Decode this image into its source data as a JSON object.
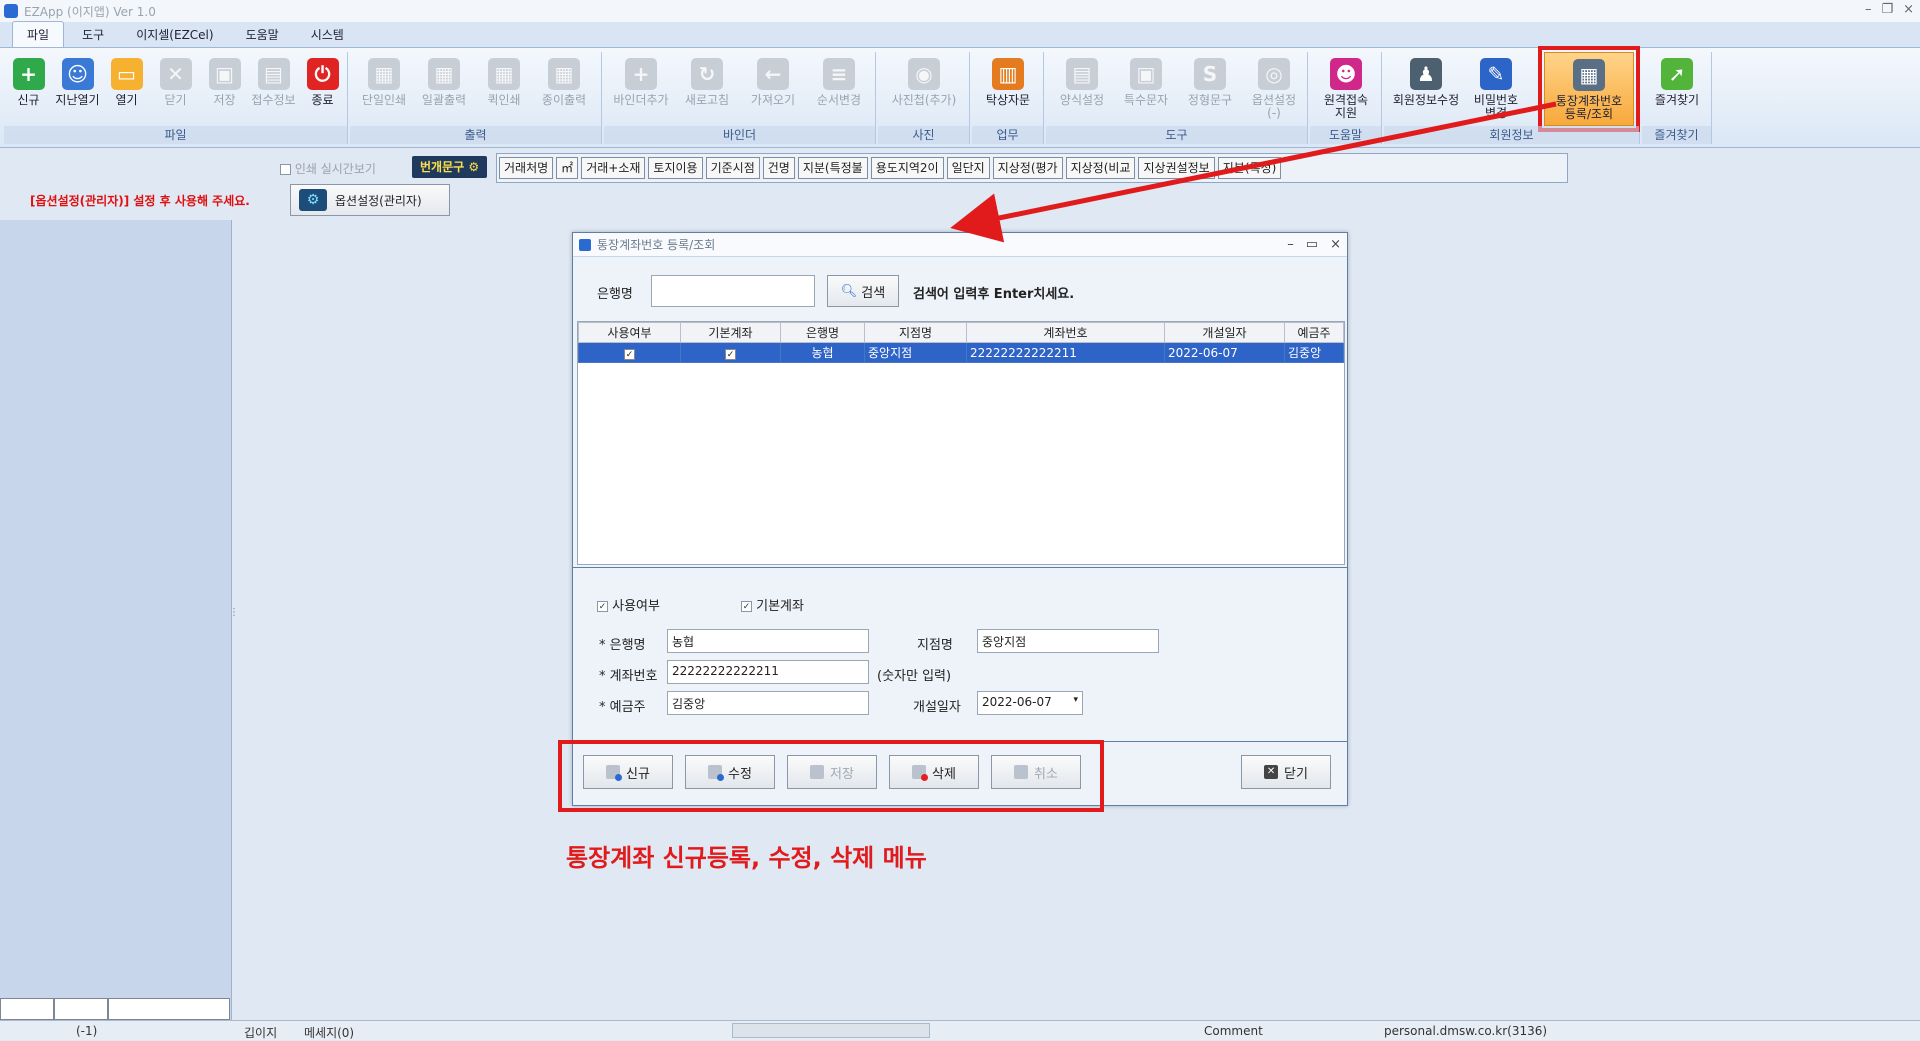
{
  "app": {
    "title": "EZApp (이지앱)  Ver 1.0"
  },
  "tabs": [
    "파일",
    "도구",
    "이지셀(EZCel)",
    "도움말",
    "시스템"
  ],
  "ribbon": {
    "file": {
      "name": "파일",
      "buttons": [
        "신규",
        "지난열기",
        "열기",
        "닫기",
        "저장",
        "접수정보",
        "종료"
      ]
    },
    "print": {
      "name": "출력",
      "buttons": [
        "단일인쇄",
        "일괄출력",
        "퀵인쇄",
        "종이출력"
      ]
    },
    "binder": {
      "name": "바인더",
      "buttons": [
        "바인더추가",
        "새로고침",
        "가져오기",
        "순서변경"
      ]
    },
    "photo": {
      "name": "사진",
      "buttons": [
        "사진첩(추가)"
      ]
    },
    "work": {
      "name": "업무",
      "buttons": [
        "탁상자문"
      ]
    },
    "tools": {
      "name": "도구",
      "buttons": [
        "양식설정",
        "특수문자",
        "정형문구",
        "옵션설정\n(-)"
      ]
    },
    "help": {
      "name": "도움말",
      "buttons": [
        "원격접속\n지원"
      ]
    },
    "member": {
      "name": "회원정보",
      "buttons": [
        "회원정보수정",
        "비밀번호\n변경",
        "통장계좌번호\n등록/조회"
      ]
    },
    "fav": {
      "name": "즐겨찾기",
      "buttons": [
        "즐겨찾기"
      ]
    }
  },
  "row2": {
    "print_preview": "인쇄 실시간보기",
    "phrase_label": "번개문구",
    "chips": [
      "거래처명",
      "㎡",
      "거래+소재",
      "토지이용",
      "기준시점",
      "건명",
      "지분(특정불",
      "용도지역2이",
      "일단지",
      "지상정(평가",
      "지상정(비교",
      "지상권설정보",
      "지분(특정)"
    ],
    "option_warning": "[옵션설정(관리자)] 설정 후 사용해 주세요.",
    "option_button": "옵션설정(관리자)"
  },
  "dialog": {
    "title": "통장계좌번호 등록/조회",
    "search_label": "은행명",
    "search_value": "",
    "search_button": "검색",
    "search_hint": "검색어 입력후 Enter치세요.",
    "columns": [
      "사용여부",
      "기본계좌",
      "은행명",
      "지점명",
      "계좌번호",
      "개설일자",
      "예금주"
    ],
    "rows": [
      {
        "use": "✓",
        "default": "✓",
        "bank": "농협",
        "branch": "중앙지점",
        "account": "22222222222211",
        "opened": "2022-06-07",
        "holder": "김중앙"
      }
    ],
    "form": {
      "use_label": "사용여부",
      "default_label": "기본계좌",
      "bank_label": "* 은행명",
      "bank_value": "농협",
      "branch_label": "지점명",
      "branch_value": "중앙지점",
      "account_label": "* 계좌번호",
      "account_value": "22222222222211",
      "account_hint": "(숫자만 입력)",
      "holder_label": "* 예금주",
      "holder_value": "김중앙",
      "opened_label": "개설일자",
      "opened_value": "2022-06-07"
    },
    "buttons": {
      "new": "신규",
      "edit": "수정",
      "save": "저장",
      "delete": "삭제",
      "cancel": "취소",
      "close": "닫기"
    }
  },
  "annotation": "통장계좌 신규등록, 수정, 삭제 메뉴",
  "status": {
    "pos": "(-1)",
    "page": "깁이지",
    "msg": "메세지(0)",
    "comment": "Comment",
    "user": "personal.dmsw.co.kr(3136)"
  },
  "colors": {
    "accent": "#2e63c7",
    "highlight": "#e11b1b"
  }
}
